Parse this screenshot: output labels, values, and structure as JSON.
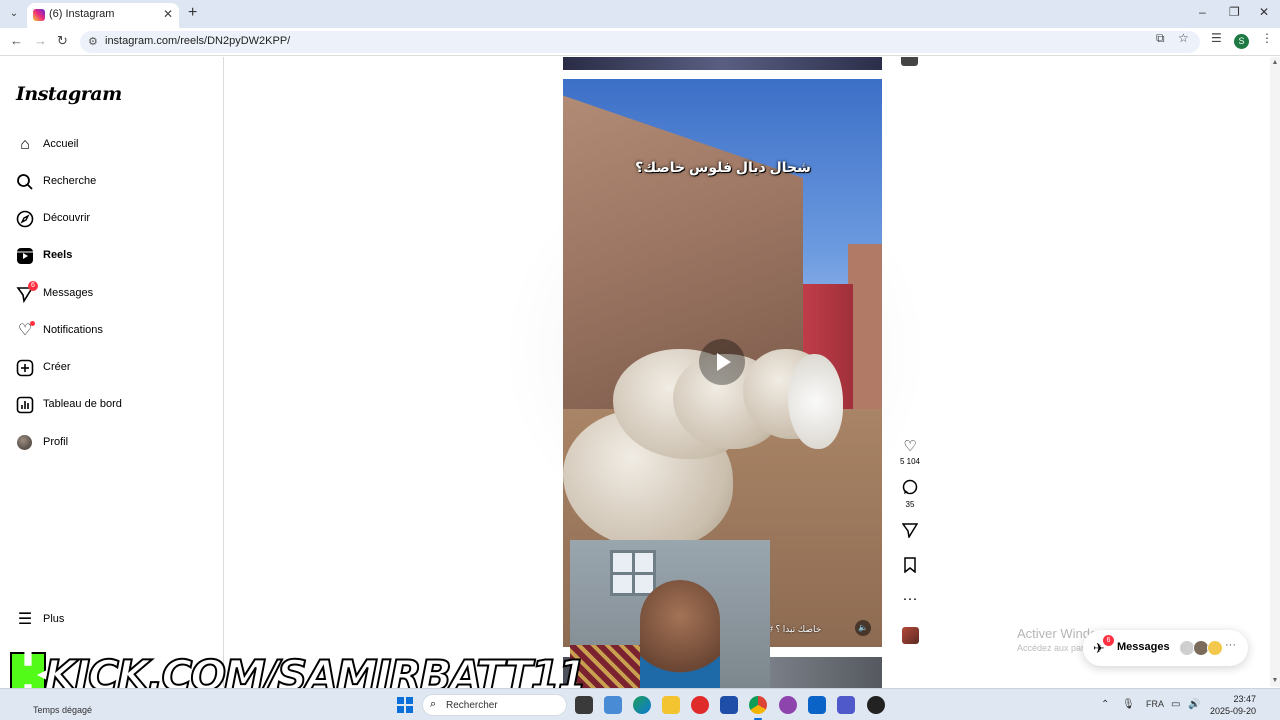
{
  "browser": {
    "tab_title": "(6) Instagram",
    "url": "instagram.com/reels/DN2pyDW2KPP/",
    "profile_initial": "S"
  },
  "sidebar": {
    "logo": "Instagram",
    "items": [
      {
        "label": "Accueil",
        "icon": "home-icon"
      },
      {
        "label": "Recherche",
        "icon": "search-icon"
      },
      {
        "label": "Découvrir",
        "icon": "compass-icon"
      },
      {
        "label": "Reels",
        "icon": "reels-icon"
      },
      {
        "label": "Messages",
        "icon": "messenger-icon",
        "badge": "6"
      },
      {
        "label": "Notifications",
        "icon": "heart-icon"
      },
      {
        "label": "Créer",
        "icon": "plus-square-icon"
      },
      {
        "label": "Tableau de bord",
        "icon": "dashboard-icon"
      },
      {
        "label": "Profil",
        "icon": "avatar-icon"
      }
    ],
    "more_label": "Plus"
  },
  "reel": {
    "caption": "شحال ديال فلوس خاصك؟",
    "hashtag": "خاصك تبدا ؟ #",
    "likes": "5 104",
    "comments": "35"
  },
  "overlay": {
    "kick_text": "KICK.COM/SAMIRBATT11"
  },
  "watermark": {
    "title": "Activer Windows",
    "subtitle": "Accédez aux paramètres"
  },
  "messages_pill": {
    "label": "Messages",
    "badge": "6"
  },
  "taskbar": {
    "weather": "Temps dégagé",
    "search_label": "Rechercher",
    "language": "FRA",
    "time": "23:47",
    "date": "2025-09-20"
  },
  "colors": {
    "accent_red": "#ff3040",
    "kick_green": "#53fc18",
    "windows_blue": "#0a6fd8"
  }
}
